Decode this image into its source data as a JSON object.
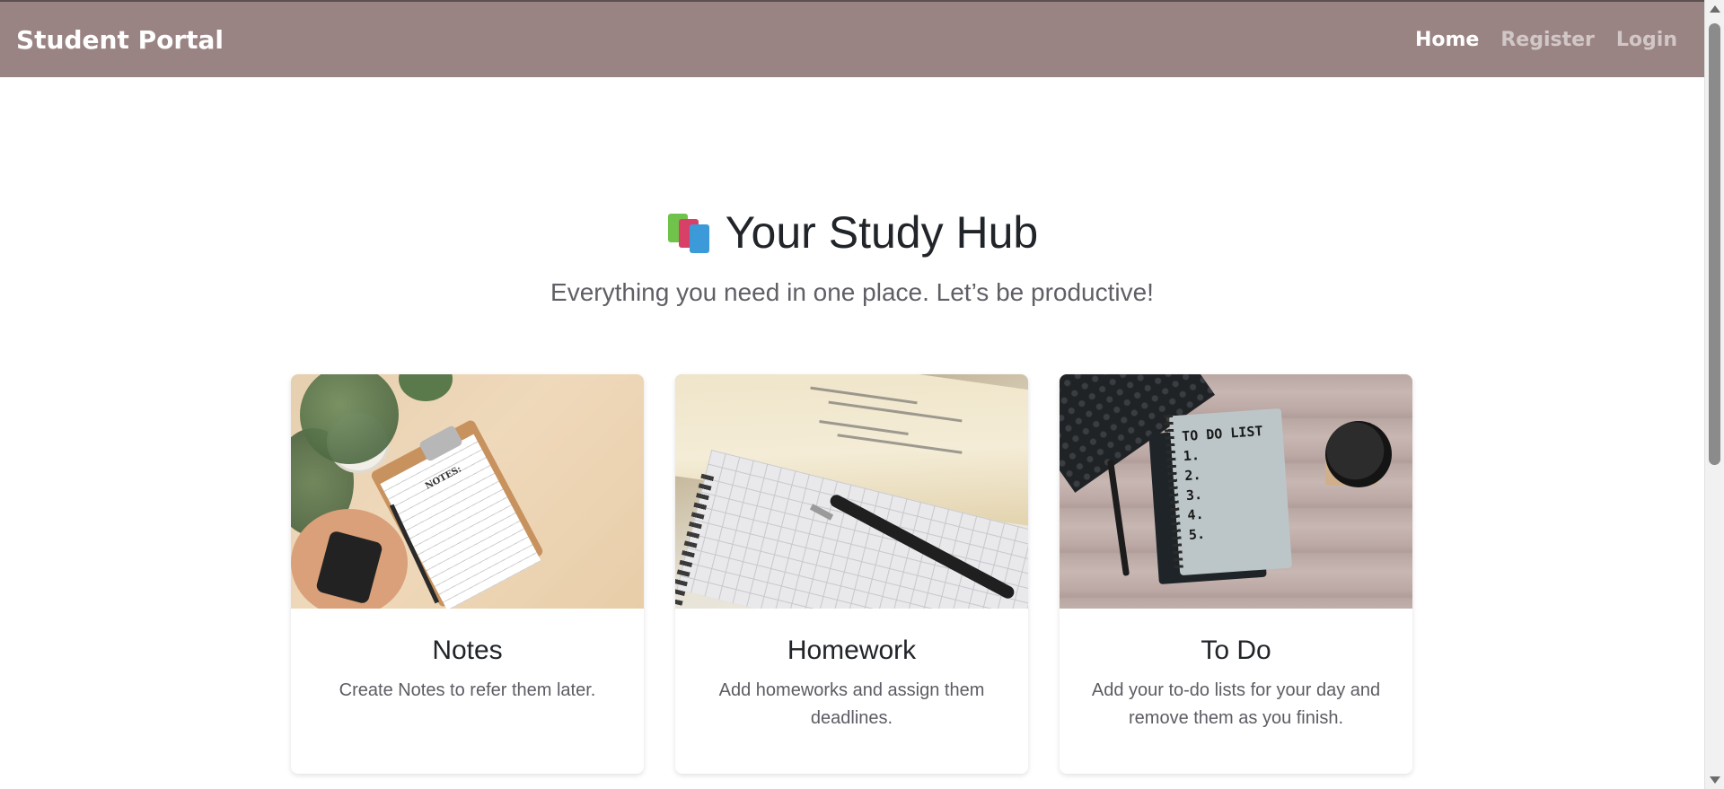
{
  "navbar": {
    "brand": "Student Portal",
    "links": [
      {
        "label": "Home",
        "active": true
      },
      {
        "label": "Register",
        "active": false
      },
      {
        "label": "Login",
        "active": false
      }
    ]
  },
  "hero": {
    "icon": "books-icon",
    "title": "Your Study Hub",
    "subtitle": "Everything you need in one place. Let’s be productive!"
  },
  "cards": [
    {
      "image": "notes-clipboard-image",
      "title": "Notes",
      "text": "Create Notes to refer them later."
    },
    {
      "image": "homework-book-image",
      "title": "Homework",
      "text": "Add homeworks and assign them deadlines."
    },
    {
      "image": "todo-notebook-image",
      "title": "To Do",
      "text": "Add your to-do lists for your day and remove them as you finish."
    }
  ],
  "todo_image_text": "TO DO LIST\n1.\n2.\n3.\n4.\n5.",
  "notes_image_text": "NOTES:",
  "colors": {
    "navbar_bg": "#9a8483",
    "nav_active": "#ffffff",
    "nav_inactive": "rgba(255,255,255,0.55)"
  }
}
